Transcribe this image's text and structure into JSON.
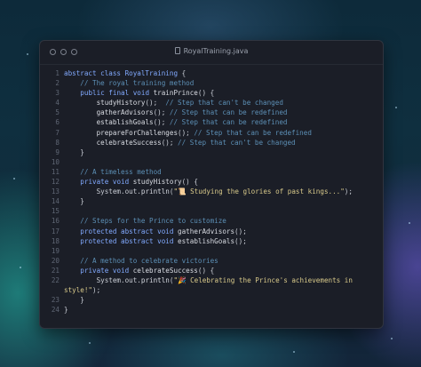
{
  "window": {
    "title": "RoyalTraining.java"
  },
  "code_lines": [
    {
      "n": "1",
      "indent": 0,
      "parts": [
        {
          "t": "abstract class ",
          "c": "kw"
        },
        {
          "t": "RoyalTraining",
          "c": "cls"
        },
        {
          "t": " {",
          "c": "pl"
        }
      ]
    },
    {
      "n": "2",
      "indent": 1,
      "parts": [
        {
          "t": "// The royal training method",
          "c": "cm"
        }
      ]
    },
    {
      "n": "3",
      "indent": 1,
      "parts": [
        {
          "t": "public final void ",
          "c": "kw"
        },
        {
          "t": "trainPrince",
          "c": "fn"
        },
        {
          "t": "() {",
          "c": "pl"
        }
      ]
    },
    {
      "n": "4",
      "indent": 2,
      "parts": [
        {
          "t": "studyHistory",
          "c": "fn"
        },
        {
          "t": "();  ",
          "c": "pl"
        },
        {
          "t": "// Step that can't be changed",
          "c": "cm"
        }
      ]
    },
    {
      "n": "5",
      "indent": 2,
      "parts": [
        {
          "t": "gatherAdvisors",
          "c": "fn"
        },
        {
          "t": "(); ",
          "c": "pl"
        },
        {
          "t": "// Step that can be redefined",
          "c": "cm"
        }
      ]
    },
    {
      "n": "6",
      "indent": 2,
      "parts": [
        {
          "t": "establishGoals",
          "c": "fn"
        },
        {
          "t": "(); ",
          "c": "pl"
        },
        {
          "t": "// Step that can be redefined",
          "c": "cm"
        }
      ]
    },
    {
      "n": "7",
      "indent": 2,
      "parts": [
        {
          "t": "prepareForChallenges",
          "c": "fn"
        },
        {
          "t": "(); ",
          "c": "pl"
        },
        {
          "t": "// Step that can be redefined",
          "c": "cm"
        }
      ]
    },
    {
      "n": "8",
      "indent": 2,
      "parts": [
        {
          "t": "celebrateSuccess",
          "c": "fn"
        },
        {
          "t": "(); ",
          "c": "pl"
        },
        {
          "t": "// Step that can't be changed",
          "c": "cm"
        }
      ]
    },
    {
      "n": "9",
      "indent": 1,
      "parts": [
        {
          "t": "}",
          "c": "pl"
        }
      ]
    },
    {
      "n": "10",
      "indent": 0,
      "parts": []
    },
    {
      "n": "11",
      "indent": 1,
      "parts": [
        {
          "t": "// A timeless method",
          "c": "cm"
        }
      ]
    },
    {
      "n": "12",
      "indent": 1,
      "parts": [
        {
          "t": "private void ",
          "c": "kw"
        },
        {
          "t": "studyHistory",
          "c": "fn"
        },
        {
          "t": "() {",
          "c": "pl"
        }
      ]
    },
    {
      "n": "13",
      "indent": 2,
      "parts": [
        {
          "t": "System.out.",
          "c": "pl"
        },
        {
          "t": "println",
          "c": "fn"
        },
        {
          "t": "(",
          "c": "pl"
        },
        {
          "t": "\"📜 Studying the glories of past kings...\"",
          "c": "str"
        },
        {
          "t": ");",
          "c": "pl"
        }
      ]
    },
    {
      "n": "14",
      "indent": 1,
      "parts": [
        {
          "t": "}",
          "c": "pl"
        }
      ]
    },
    {
      "n": "15",
      "indent": 0,
      "parts": []
    },
    {
      "n": "16",
      "indent": 1,
      "parts": [
        {
          "t": "// Steps for the Prince to customize",
          "c": "cm"
        }
      ]
    },
    {
      "n": "17",
      "indent": 1,
      "parts": [
        {
          "t": "protected abstract void ",
          "c": "kw"
        },
        {
          "t": "gatherAdvisors",
          "c": "fn"
        },
        {
          "t": "();",
          "c": "pl"
        }
      ]
    },
    {
      "n": "18",
      "indent": 1,
      "parts": [
        {
          "t": "protected abstract void ",
          "c": "kw"
        },
        {
          "t": "establishGoals",
          "c": "fn"
        },
        {
          "t": "();",
          "c": "pl"
        }
      ]
    },
    {
      "n": "19",
      "indent": 0,
      "parts": []
    },
    {
      "n": "20",
      "indent": 1,
      "parts": [
        {
          "t": "// A method to celebrate victories",
          "c": "cm"
        }
      ]
    },
    {
      "n": "21",
      "indent": 1,
      "parts": [
        {
          "t": "private void ",
          "c": "kw"
        },
        {
          "t": "celebrateSuccess",
          "c": "fn"
        },
        {
          "t": "() {",
          "c": "pl"
        }
      ]
    },
    {
      "n": "22",
      "indent": 2,
      "parts": [
        {
          "t": "System.out.",
          "c": "pl"
        },
        {
          "t": "println",
          "c": "fn"
        },
        {
          "t": "(",
          "c": "pl"
        },
        {
          "t": "\"🎉 Celebrating the Prince's achievements in",
          "c": "str"
        }
      ]
    },
    {
      "n": "",
      "indent": 0,
      "parts": [
        {
          "t": "style!\"",
          "c": "str"
        },
        {
          "t": ");",
          "c": "pl"
        }
      ]
    },
    {
      "n": "23",
      "indent": 1,
      "parts": [
        {
          "t": "}",
          "c": "pl"
        }
      ]
    },
    {
      "n": "24",
      "indent": 0,
      "parts": [
        {
          "t": "}",
          "c": "pl"
        }
      ]
    }
  ],
  "colors": {
    "keyword": "#82aaff",
    "comment": "#5c8fb5",
    "string": "#d8c98a",
    "editor_bg": "#1b1e27"
  }
}
